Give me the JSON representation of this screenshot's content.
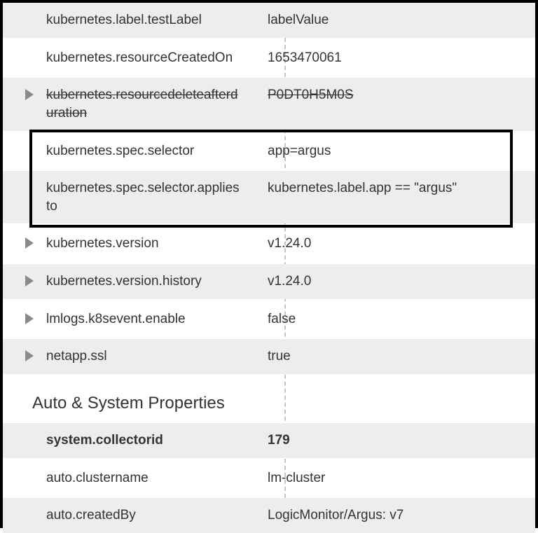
{
  "properties": [
    {
      "key": "kubernetes.label.testLabel",
      "value": "labelValue",
      "striped": true,
      "expandable": false,
      "strikethrough": false
    },
    {
      "key": "kubernetes.resourceCreatedOn",
      "value": "1653470061",
      "striped": false,
      "expandable": false,
      "strikethrough": false
    },
    {
      "key": "kubernetes.resourcedeleteafterduration",
      "value": "P0DT0H5M0S",
      "striped": true,
      "expandable": true,
      "strikethrough": true
    },
    {
      "key": "kubernetes.spec.selector",
      "value": "app=argus",
      "striped": false,
      "expandable": false,
      "strikethrough": false,
      "highlightStart": true
    },
    {
      "key": "kubernetes.spec.selector.appliesto",
      "value": "kubernetes.label.app == \"argus\"",
      "striped": true,
      "expandable": false,
      "strikethrough": false,
      "highlightEnd": true
    },
    {
      "key": "kubernetes.version",
      "value": "v1.24.0",
      "striped": false,
      "expandable": true,
      "strikethrough": false
    },
    {
      "key": "kubernetes.version.history",
      "value": "v1.24.0",
      "striped": true,
      "expandable": true,
      "strikethrough": false
    },
    {
      "key": "lmlogs.k8sevent.enable",
      "value": "false",
      "striped": false,
      "expandable": true,
      "strikethrough": false
    },
    {
      "key": "netapp.ssl",
      "value": "true",
      "striped": true,
      "expandable": true,
      "strikethrough": false
    }
  ],
  "section2": {
    "title": "Auto & System Properties",
    "rows": [
      {
        "key": "system.collectorid",
        "value": "179",
        "striped": true,
        "bold": true
      },
      {
        "key": "auto.clustername",
        "value": "lm-cluster",
        "striped": false,
        "bold": false
      },
      {
        "key": "auto.createdBy",
        "value": "LogicMonitor/Argus: v7",
        "striped": true,
        "bold": false
      }
    ]
  }
}
